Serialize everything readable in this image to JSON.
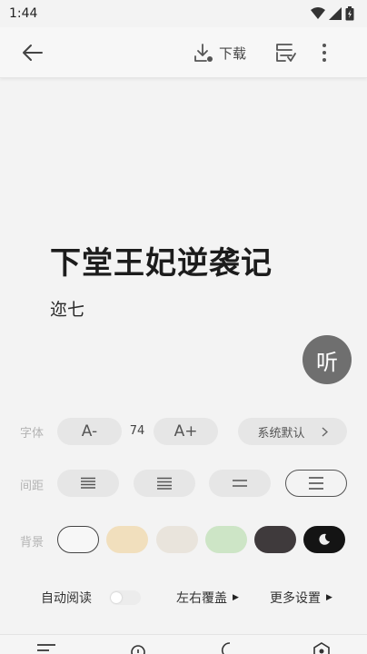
{
  "status_bar": {
    "time": "1:44"
  },
  "toolbar": {
    "download_label": "下载"
  },
  "book": {
    "title": "下堂王妃逆袭记",
    "author": "迩七"
  },
  "listen_label": "听",
  "settings": {
    "font": {
      "label": "字体",
      "decrease": "A-",
      "size": "74",
      "increase": "A+",
      "family": "系统默认"
    },
    "spacing": {
      "label": "间距"
    },
    "background": {
      "label": "背景",
      "swatches": [
        "#f7f7f7",
        "#f1dfbd",
        "#e9e4dc",
        "#cde5c6",
        "#3f3a3c",
        "#141414"
      ]
    },
    "auto_read": "自动阅读",
    "page_mode": "左右覆盖",
    "more": "更多设置"
  },
  "colors": {
    "accent": "#6f6f6f",
    "bg": "#f3f3f3"
  }
}
